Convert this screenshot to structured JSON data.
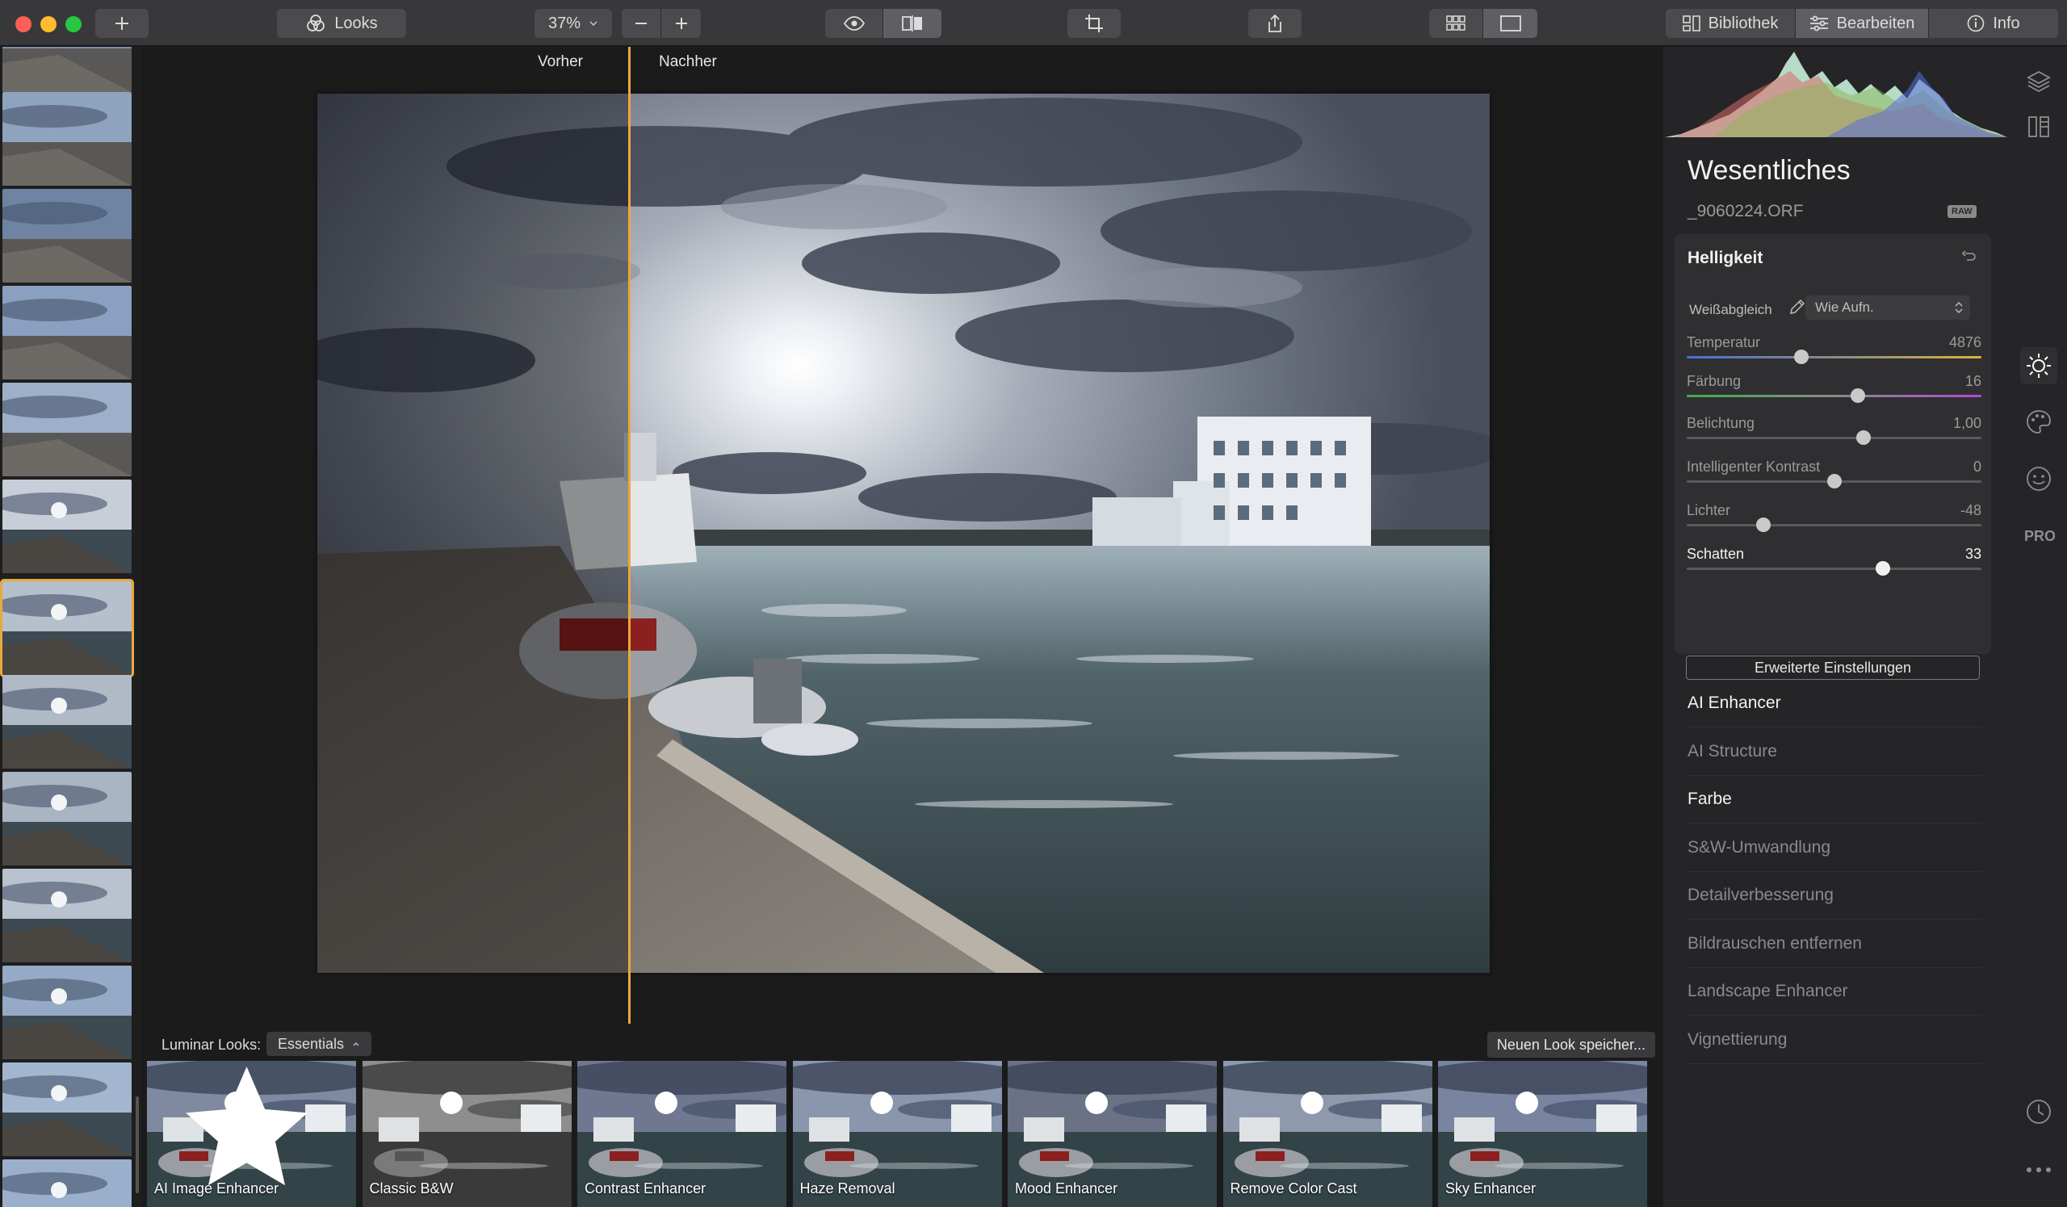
{
  "toolbar": {
    "looks_label": "Looks",
    "zoom_value": "37%",
    "tabs": [
      {
        "label": "Bibliothek",
        "icon": "library-icon"
      },
      {
        "label": "Bearbeiten",
        "icon": "sliders-icon",
        "active": true
      },
      {
        "label": "Info",
        "icon": "info-icon"
      }
    ]
  },
  "compare": {
    "before": "Vorher",
    "after": "Nachher"
  },
  "panel": {
    "title": "Wesentliches",
    "filename": "_9060224.ORF",
    "raw_badge": "RAW",
    "card_title": "Helligkeit",
    "wb_label": "Weißabgleich",
    "wb_value": "Wie Aufn.",
    "sliders": [
      {
        "name": "Temperatur",
        "value": "4876",
        "pos": 0.39
      },
      {
        "name": "Färbung",
        "value": "16",
        "pos": 0.58
      },
      {
        "name": "Belichtung",
        "value": "1,00",
        "pos": 0.6
      },
      {
        "name": "Intelligenter Kontrast",
        "value": "0",
        "pos": 0.5
      },
      {
        "name": "Lichter",
        "value": "-48",
        "pos": 0.26
      },
      {
        "name": "Schatten",
        "value": "33",
        "pos": 0.665
      }
    ],
    "advanced_button": "Erweiterte Einstellungen",
    "tools": [
      {
        "label": "AI Enhancer",
        "state": "on"
      },
      {
        "label": "AI Structure",
        "state": "off"
      },
      {
        "label": "Farbe",
        "state": "on"
      },
      {
        "label": "S&W-Umwandlung",
        "state": "off"
      },
      {
        "label": "Detailverbesserung",
        "state": "off"
      },
      {
        "label": "Bildrauschen entfernen",
        "state": "off"
      },
      {
        "label": "Landscape Enhancer",
        "state": "off"
      },
      {
        "label": "Vignettierung",
        "state": "off"
      }
    ]
  },
  "looks": {
    "label": "Luminar Looks:",
    "collection": "Essentials",
    "save_button": "Neuen Look speicher...",
    "items": [
      {
        "label": "AI Image Enhancer"
      },
      {
        "label": "Classic B&W"
      },
      {
        "label": "Contrast Enhancer"
      },
      {
        "label": "Haze Removal"
      },
      {
        "label": "Mood Enhancer"
      },
      {
        "label": "Remove Color Cast"
      },
      {
        "label": "Sky Enhancer"
      }
    ]
  },
  "colors": {
    "accent": "#e9a93c",
    "panel_bg": "#252527",
    "toolbar_bg": "#38383a"
  }
}
